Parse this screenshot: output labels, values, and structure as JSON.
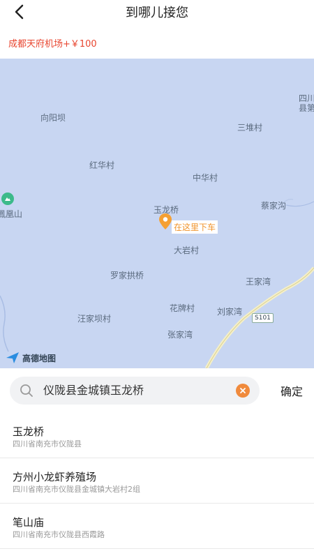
{
  "header": {
    "title": "到哪儿接您"
  },
  "price_bar": {
    "text": "成都天府机场+￥100"
  },
  "map": {
    "places": [
      "向阳坝",
      "三堆村",
      "红华村",
      "中华村",
      "鳳凰山",
      "蔡家沟",
      "玉龙桥",
      "大岩村",
      "罗家拱桥",
      "王家湾",
      "花牌村",
      "刘家湾",
      "汪家坝村",
      "张家湾",
      "四川",
      "县第"
    ],
    "marker_label": "在这里下车",
    "road_badge": "S101",
    "logo_text": "高德地图"
  },
  "search": {
    "value": "仪陇县金城镇玉龙桥",
    "confirm_label": "确定"
  },
  "results": [
    {
      "name": "玉龙桥",
      "address": "四川省南充市仪陇县"
    },
    {
      "name": "方州小龙虾养殖场",
      "address": "四川省南充市仪陇县金城镇大岩村2组"
    },
    {
      "name": "笔山庙",
      "address": "四川省南充市仪陇县西霞路"
    }
  ]
}
